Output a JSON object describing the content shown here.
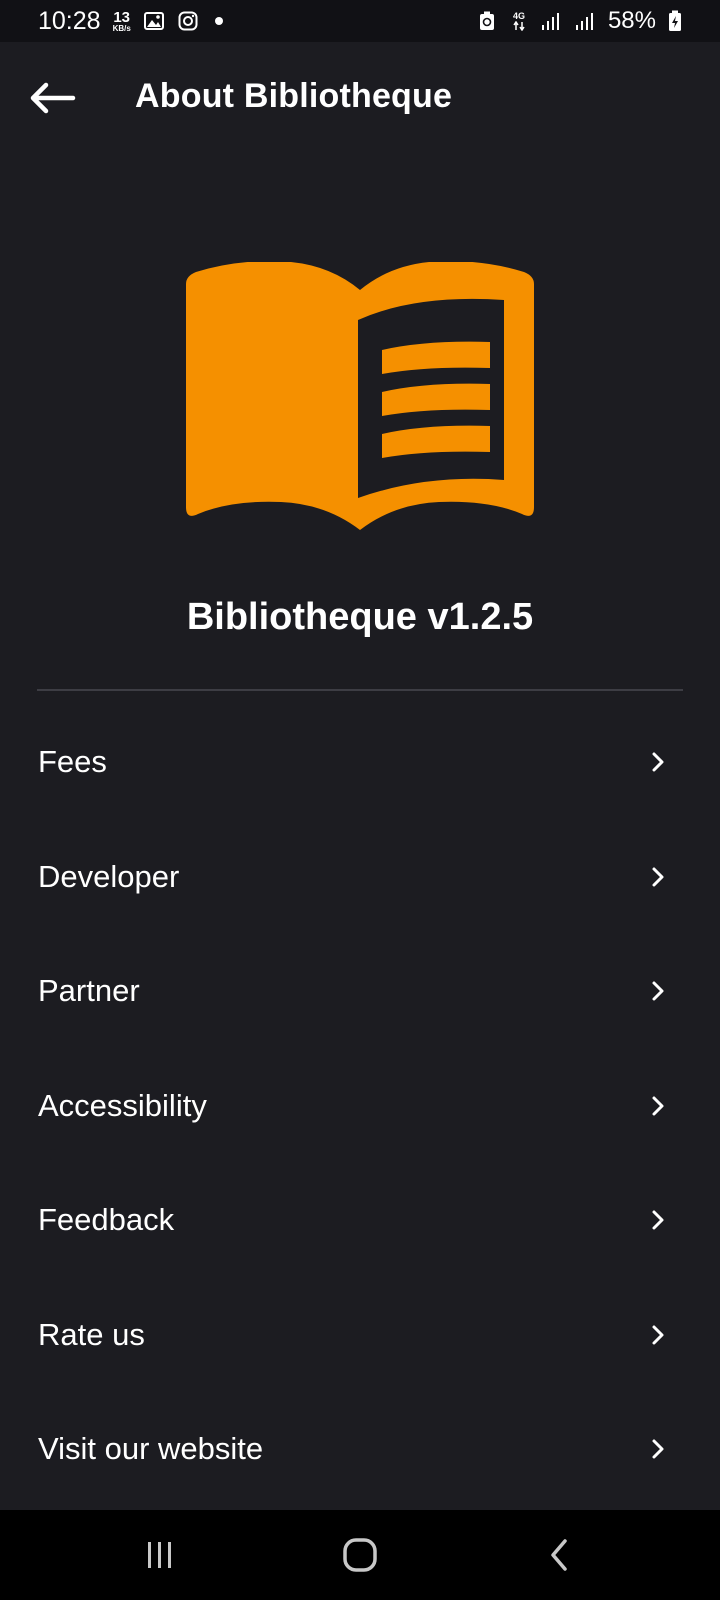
{
  "status_bar": {
    "time": "10:28",
    "speed_value": "13",
    "speed_unit": "KB/s",
    "network": "4G",
    "battery": "58%"
  },
  "app_bar": {
    "title": "About Bibliotheque"
  },
  "logo": {
    "icon": "open-book-icon",
    "color": "#f59000"
  },
  "app_version": "Bibliotheque v1.2.5",
  "menu": [
    {
      "label": "Fees",
      "icon": "chevron-right-icon"
    },
    {
      "label": "Developer",
      "icon": "chevron-right-icon"
    },
    {
      "label": "Partner",
      "icon": "chevron-right-icon"
    },
    {
      "label": "Accessibility",
      "icon": "chevron-right-icon"
    },
    {
      "label": "Feedback",
      "icon": "chevron-right-icon"
    },
    {
      "label": "Rate us",
      "icon": "chevron-right-icon"
    },
    {
      "label": "Visit our website",
      "icon": "chevron-right-icon"
    }
  ],
  "nav_bar": {
    "icons": [
      "recent-apps-icon",
      "home-icon",
      "back-icon"
    ]
  },
  "colors": {
    "background": "#1c1c21",
    "accent": "#f59000",
    "text": "#ffffff",
    "divider": "#3d3d44"
  }
}
